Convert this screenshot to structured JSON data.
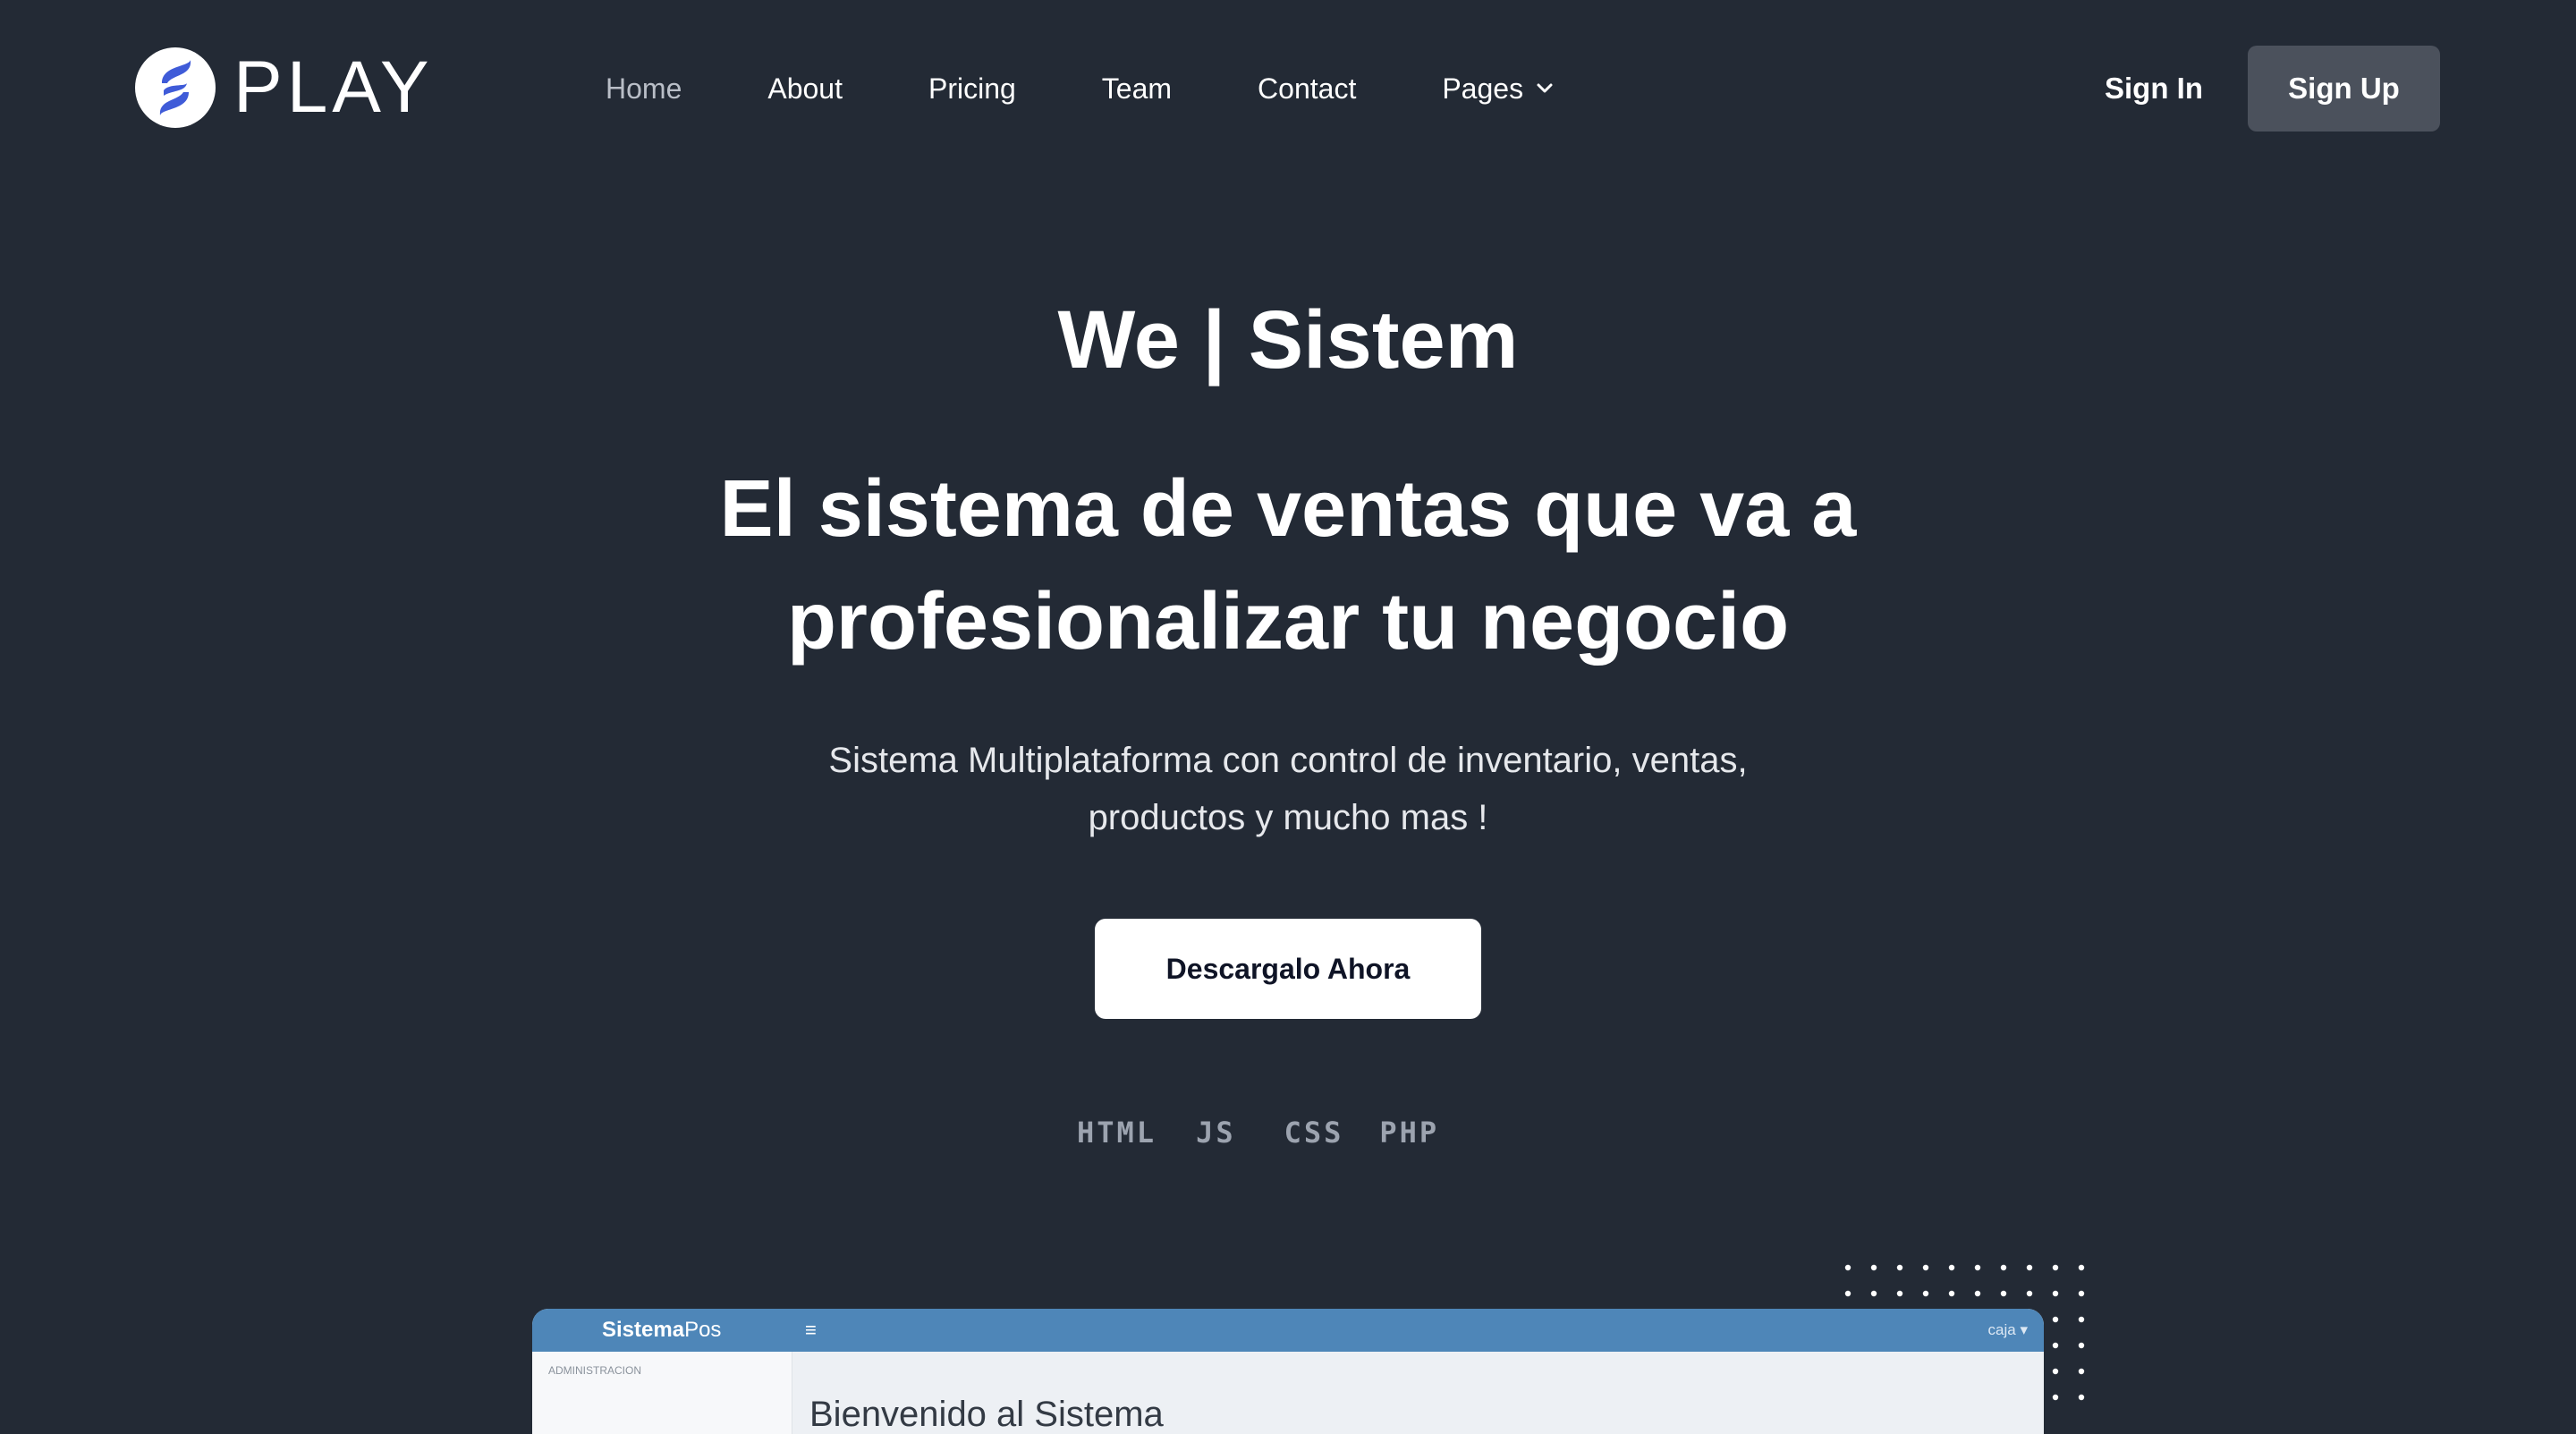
{
  "header": {
    "logo_text": "PLAY",
    "nav": [
      {
        "label": "Home",
        "active": true
      },
      {
        "label": "About"
      },
      {
        "label": "Pricing"
      },
      {
        "label": "Team"
      },
      {
        "label": "Contact"
      },
      {
        "label": "Pages",
        "has_dropdown": true
      }
    ],
    "signin_label": "Sign In",
    "signup_label": "Sign Up"
  },
  "hero": {
    "brand": "We | Sistem",
    "title": "El sistema de ventas que va a profesionalizar tu negocio",
    "subtitle": "Sistema Multiplataforma con control de inventario, ventas, productos y mucho mas !",
    "cta_label": "Descargalo Ahora",
    "tech": [
      "HTML",
      "JS",
      "CSS",
      "PHP"
    ]
  },
  "preview": {
    "brand_bold": "Sistema",
    "brand_rest": "Pos",
    "menu_icon": "≡",
    "user_menu": "caja ▾",
    "sidebar_label": "ADMINISTRACION",
    "welcome": "Bienvenido al Sistema"
  },
  "colors": {
    "background": "#232a35",
    "signup_bg": "#4b515c",
    "cta_bg": "#ffffff",
    "preview_bar": "#4e86b8",
    "logo_accent": "#3f5bd8"
  }
}
